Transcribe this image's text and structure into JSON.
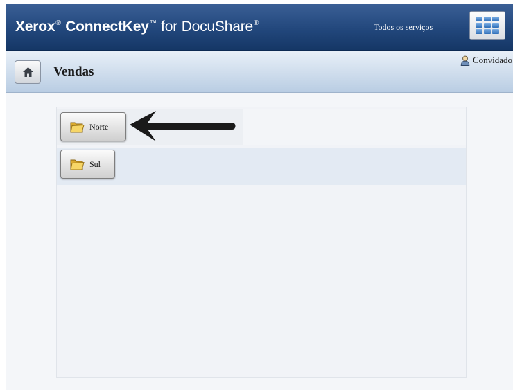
{
  "header": {
    "brand_part1": "Xerox",
    "brand_part2": "ConnectKey",
    "brand_part3": "for DocuShare",
    "registered_mark": "®",
    "trademark": "™",
    "services_label": "Todos os serviços",
    "services_icon": "grid-icon"
  },
  "subheader": {
    "home_icon": "home-icon",
    "title": "Vendas",
    "user_icon": "user-icon",
    "user_label": "Convidado"
  },
  "folders": [
    {
      "label": "Norte",
      "icon": "folder-icon"
    },
    {
      "label": "Sul",
      "icon": "folder-icon"
    }
  ],
  "annotation": {
    "icon": "arrow-left-icon",
    "color": "#1a1a1a"
  },
  "colors": {
    "header_bg": "#22477c",
    "subheader_bg": "#c6d7ea",
    "folder_yellow": "#f0c949"
  }
}
